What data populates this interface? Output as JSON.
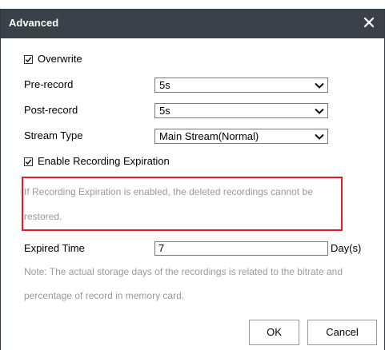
{
  "dialog": {
    "title": "Advanced"
  },
  "overwrite": {
    "label": "Overwrite",
    "checked": true
  },
  "pre_record": {
    "label": "Pre-record",
    "value": "5s"
  },
  "post_record": {
    "label": "Post-record",
    "value": "5s"
  },
  "stream_type": {
    "label": "Stream Type",
    "value": "Main Stream(Normal)"
  },
  "recording_expiration": {
    "label": "Enable Recording Expiration",
    "checked": true,
    "warning_line1": "If Recording Expiration is enabled, the deleted recordings cannot be",
    "warning_line2": "restored."
  },
  "expired_time": {
    "label": "Expired Time",
    "value": "7",
    "unit": "Day(s)"
  },
  "note": {
    "line1": "Note: The actual storage days of the recordings is related to the bitrate and",
    "line2": "percentage of record in memory card."
  },
  "buttons": {
    "ok": "OK",
    "cancel": "Cancel"
  },
  "colors": {
    "titlebar": "#3a4148",
    "highlight": "#e31b2b",
    "note_text": "#9a9a9a"
  },
  "icons": {
    "close": "close-icon",
    "checkbox": "checkmark-icon",
    "dropdown": "chevron-down-icon"
  }
}
